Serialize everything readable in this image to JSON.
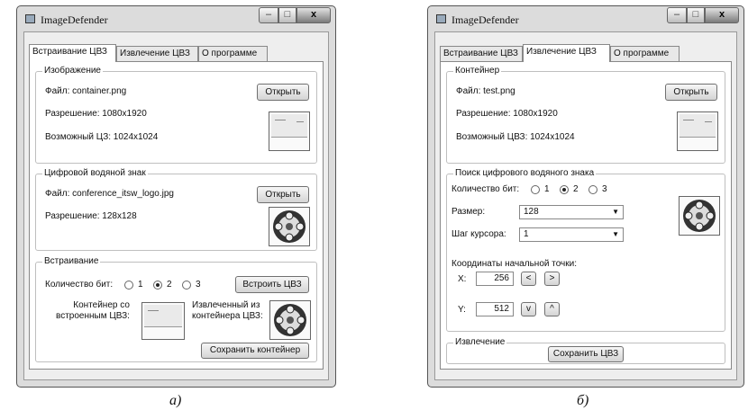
{
  "left_window": {
    "title": "ImageDefender",
    "tabs": [
      "Встраивание ЦВЗ",
      "Извлечение ЦВЗ",
      "О программе"
    ],
    "image_group": {
      "label": "Изображение",
      "file": "Файл: container.png",
      "open_button": "Открыть",
      "resolution": "Разрешение: 1080x1920",
      "capacity": "Возможный ЦЗ: 1024x1024"
    },
    "watermark_group": {
      "label": "Цифровой водяной знак",
      "file": "Файл: conference_itsw_logo.jpg",
      "open_button": "Открыть",
      "resolution": "Разрешение: 128x128"
    },
    "embed_group": {
      "label": "Встраивание",
      "bits_label": "Количество бит:",
      "bit_options": [
        "1",
        "2",
        "3"
      ],
      "selected_bits": "2",
      "embed_button": "Встроить ЦВЗ",
      "container_label_1": "Контейнер со",
      "container_label_2": "встроенным ЦВЗ:",
      "extracted_label_1": "Извлеченный из",
      "extracted_label_2": "контейнера ЦВЗ:",
      "save_button": "Сохранить контейнер"
    }
  },
  "right_window": {
    "title": "ImageDefender",
    "tabs": [
      "Встраивание ЦВЗ",
      "Извлечение ЦВЗ",
      "О программе"
    ],
    "container_group": {
      "label": "Контейнер",
      "file": "Файл: test.png",
      "open_button": "Открыть",
      "resolution": "Разрешение: 1080x1920",
      "capacity": "Возможный ЦВЗ: 1024x1024"
    },
    "search_group": {
      "label": "Поиск цифрового водяного знака",
      "bits_label": "Количество бит:",
      "bit_options": [
        "1",
        "2",
        "3"
      ],
      "selected_bits": "2",
      "size_label": "Размер:",
      "size_value": "128",
      "step_label": "Шаг курсора:",
      "step_value": "1",
      "coords_label": "Координаты начальной точки:",
      "x_label": "X:",
      "x_value": "256",
      "y_label": "Y:",
      "y_value": "512",
      "left_btn": "<",
      "right_btn": ">",
      "down_btn": "v",
      "up_btn": "^"
    },
    "extract_group": {
      "label": "Извлечение",
      "save_button": "Сохранить ЦВЗ"
    }
  },
  "captions": {
    "left": "а)",
    "right": "б)"
  },
  "window_controls": {
    "minimize": "–",
    "maximize": "□",
    "close": "x"
  }
}
